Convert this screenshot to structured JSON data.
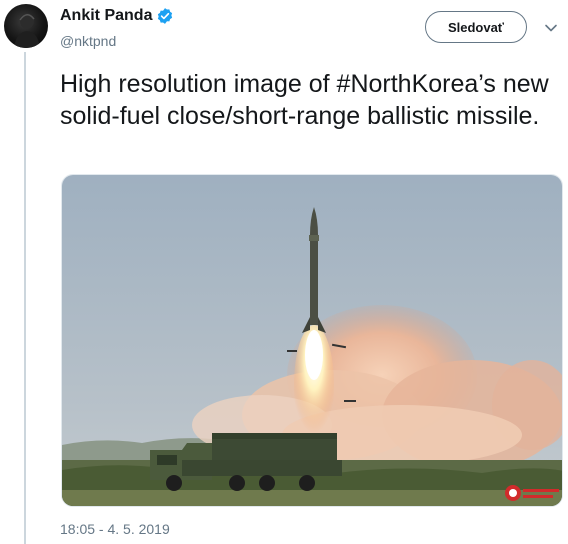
{
  "author": {
    "display_name": "Ankit Panda",
    "handle": "@nktpnd",
    "verified_icon": "verified-badge-icon",
    "verified_color": "#1da1f2"
  },
  "actions": {
    "follow_label": "Sledovať",
    "more_icon": "chevron-down-icon"
  },
  "tweet": {
    "text": "High resolution image of #NorthKorea’s new solid-fuel close/short-range ballistic missile.",
    "media_description": "photo-missile-launch",
    "timestamp": "18:05 - 4. 5. 2019"
  }
}
